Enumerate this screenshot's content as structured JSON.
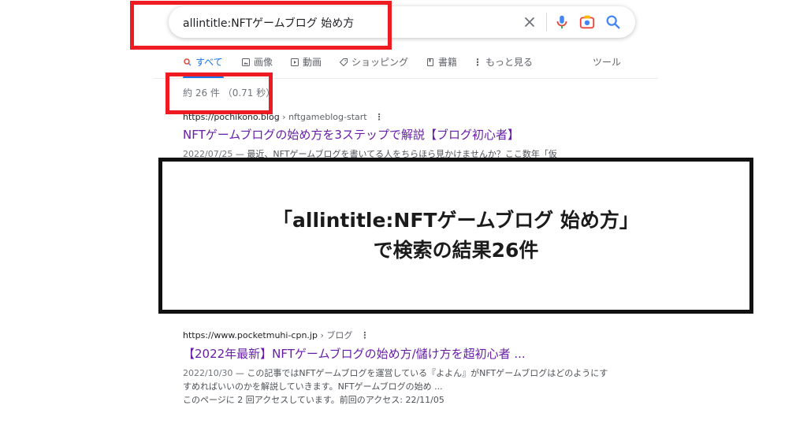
{
  "search": {
    "query": "allintitle:NFTゲームブログ 始め方"
  },
  "tabs": [
    {
      "label": "すべて",
      "icon": "search-icon"
    },
    {
      "label": "画像",
      "icon": "image-icon"
    },
    {
      "label": "動画",
      "icon": "video-icon"
    },
    {
      "label": "ショッピング",
      "icon": "tag-icon"
    },
    {
      "label": "書籍",
      "icon": "book-icon"
    },
    {
      "label": "もっと見る",
      "icon": "more-vert-icon"
    },
    {
      "label": "ツール",
      "icon": ""
    }
  ],
  "stats": "約 26 件 （0.71 秒）",
  "results": [
    {
      "site": "https://pochikono.blog",
      "path": " › nftgameblog-start",
      "title": "NFTゲームブログの始め方を3ステップで解説【ブログ初心者】",
      "date": "2022/07/25",
      "snippet": " — 最近、NFTゲームブログを書いてる人をちらほら見かけませんか？ここ数年「仮"
    },
    {
      "site": "https://www.pocketmuhi-cpn.jp",
      "path": " › ブログ",
      "title": "【2022年最新】NFTゲームブログの始め方/儲け方を超初心者 ...",
      "date": "2022/10/30",
      "snippet": " — この記事ではNFTゲームブログを運営している『よよん』がNFTゲームブログはどのようにすすめればいいのかを解説していきます。NFTゲームブログの始め ...",
      "visits": "このページに 2 回アクセスしています。前回のアクセス: 22/11/05"
    }
  ],
  "overlay": {
    "line1": "「allintitle:NFTゲームブログ 始め方」",
    "line2": "で検索の結果26件"
  },
  "colors": {
    "highlight": "#ee1b22",
    "link_visited": "#681da8",
    "accent": "#1a73e8"
  }
}
